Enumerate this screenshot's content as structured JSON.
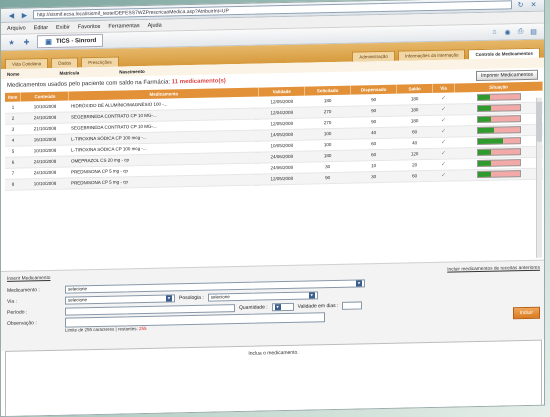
{
  "browser": {
    "url": "http://sismif.ecsa.local/sismif_teste/DEFESS7WZPrescricaoMedica.asp?AtribuirInt=UP",
    "menu": [
      "Arquivo",
      "Editar",
      "Exibir",
      "Favoritos",
      "Ferramentas",
      "Ajuda"
    ],
    "tab_title": "TICS - Sinrord"
  },
  "app_tabs": [
    "Vida Cotidiana",
    "Dados",
    "Prescrições",
    "Administração",
    "Informações da Internação",
    "Controle de Medicamentos"
  ],
  "info_labels": [
    "Nome",
    "Matrícula",
    "Nascimento"
  ],
  "header": {
    "title_prefix": "Medicamentos usados pelo paciente com saldo na Farmácia:",
    "title_count": "11 medicamento(s)",
    "print_button": "Imprimir Medicamentos"
  },
  "table": {
    "columns": [
      "Item",
      "Conteúdo",
      "Medicamento",
      "Validade",
      "Solicitado",
      "Dispensado",
      "Saldo",
      "Via",
      "Situação"
    ],
    "rows": [
      {
        "item": "1",
        "date": "10/10/2008",
        "med": "HIDRÓXIDO DE ALUMÍNIO/MAGNÉSIO 100 -...",
        "val": "12/05/2008",
        "sol": "180",
        "disp": "90",
        "saldo": "180",
        "level": 0.3
      },
      {
        "item": "2",
        "date": "24/10/2008",
        "med": "SEGEBRINEDA CONTRATO CP 10 MG-...",
        "val": "12/04/2008",
        "sol": "270",
        "disp": "90",
        "saldo": "180",
        "level": 0.33
      },
      {
        "item": "3",
        "date": "21/10/2008",
        "med": "SEGEBRINEDA CONTRATO CP 10 MG-...",
        "val": "12/05/2008",
        "sol": "270",
        "disp": "90",
        "saldo": "180",
        "level": 0.33
      },
      {
        "item": "4",
        "date": "16/10/2008",
        "med": "L-TIROXINA SÓDICA CP 100 mcg -...",
        "val": "14/05/2008",
        "sol": "100",
        "disp": "40",
        "saldo": "60",
        "level": 0.4
      },
      {
        "item": "5",
        "date": "10/10/2008",
        "med": "L-TIROXINA SÓDICA CP 100 mcg -...",
        "val": "10/05/2008",
        "sol": "100",
        "disp": "60",
        "saldo": "40",
        "level": 0.6
      },
      {
        "item": "6",
        "date": "24/10/2008",
        "med": "OMEPRAZOL CS 20 mg - cp",
        "val": "24/06/2008",
        "sol": "180",
        "disp": "60",
        "saldo": "120",
        "level": 0.33
      },
      {
        "item": "7",
        "date": "24/10/2008",
        "med": "PREDNISONA CP 5 mg - cp",
        "val": "24/06/2008",
        "sol": "30",
        "disp": "10",
        "saldo": "20",
        "level": 0.33
      },
      {
        "item": "8",
        "date": "10/10/2008",
        "med": "PREDNISONA CP 5 mg - cp",
        "val": "12/05/2008",
        "sol": "90",
        "disp": "30",
        "saldo": "60",
        "level": 0.33
      }
    ]
  },
  "form": {
    "legend": "Inserir Medicamento",
    "right_link": "Incluir medicamentos de receitas anteriores",
    "medicamento_label": "Medicamento :",
    "medicamento_value": "selecione",
    "via_label": "Via :",
    "via_value": "selecione",
    "posologia_label": "Posologia :",
    "posologia_value": "selecione",
    "periodo_label": "Período :",
    "quantidade_label": "Quantidade :",
    "validade_label": "Validade em dias :",
    "observacao_label": "Observação :",
    "note": "Limite de 255 caracteres | restantes:",
    "note_count": "255",
    "add_button": "Incluir"
  },
  "bottom_text": "Inclua o medicamento."
}
